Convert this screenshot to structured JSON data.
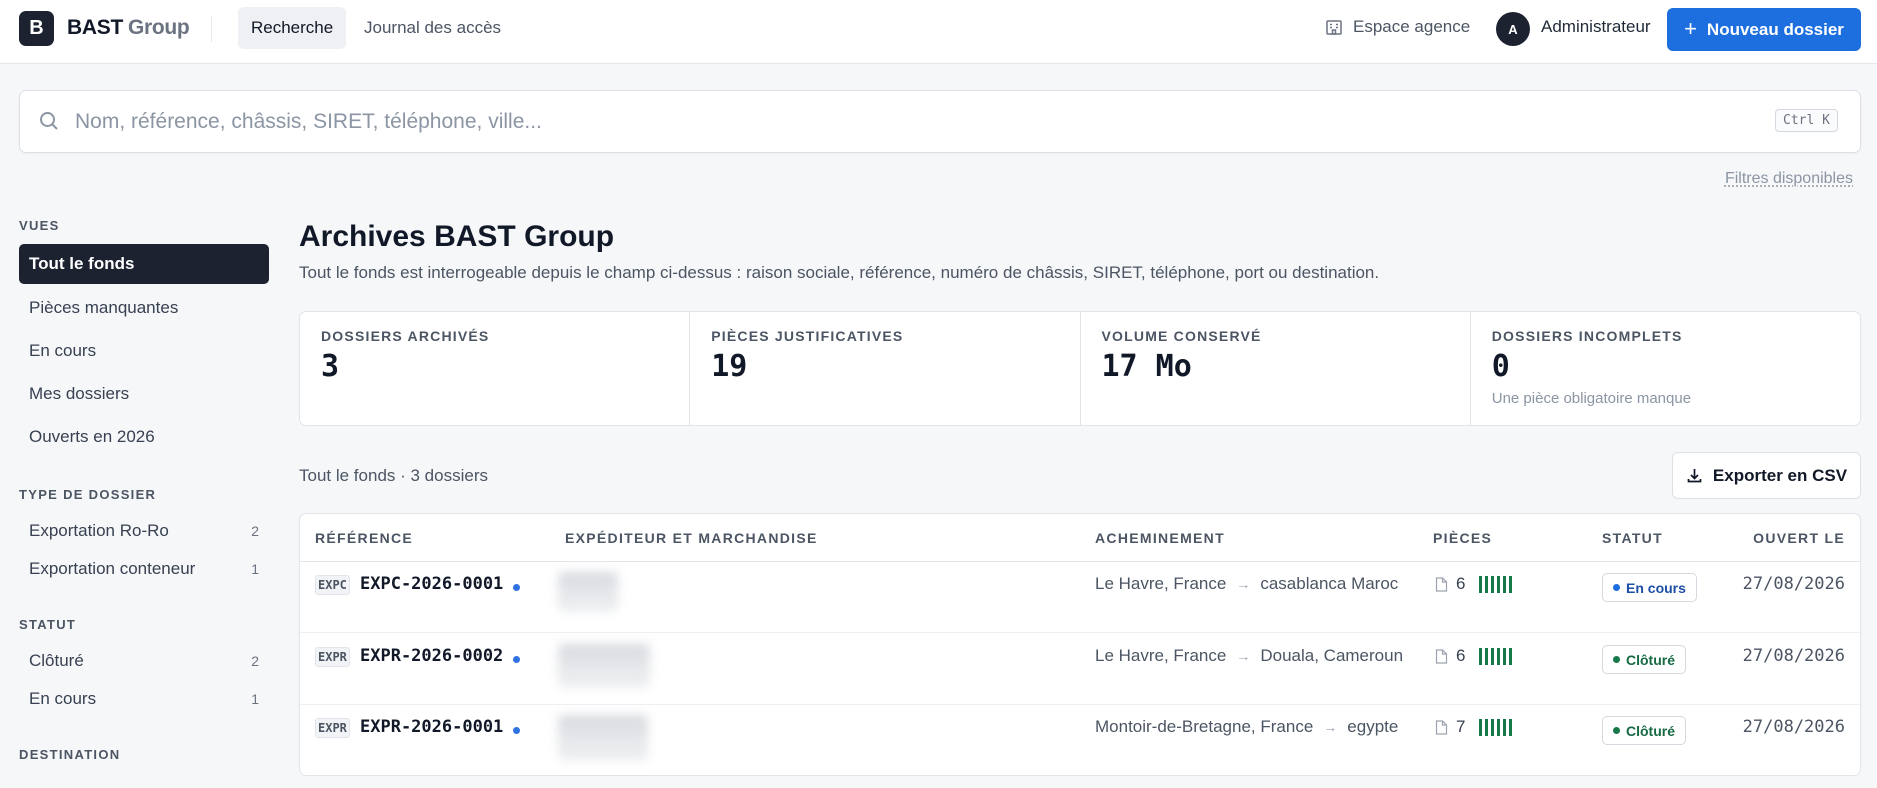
{
  "brand": {
    "logo_letter": "B",
    "name": "BAST",
    "name_suffix": "Group"
  },
  "nav": [
    {
      "label": "Recherche",
      "active": true
    },
    {
      "label": "Journal des accès",
      "active": false
    }
  ],
  "header": {
    "agence_label": "Espace agence",
    "avatar_initial": "A",
    "user_name": "Administrateur",
    "new_button": "Nouveau dossier"
  },
  "search": {
    "placeholder": "Nom, référence, châssis, SIRET, téléphone, ville...",
    "value": "",
    "shortcut": "Ctrl K",
    "filters_link": "Filtres disponibles"
  },
  "sidebar": {
    "vues": {
      "heading": "VUES",
      "items": [
        {
          "label": "Tout le fonds",
          "active": true
        },
        {
          "label": "Pièces manquantes"
        },
        {
          "label": "En cours"
        },
        {
          "label": "Mes dossiers"
        },
        {
          "label": "Ouverts en 2026"
        }
      ]
    },
    "type": {
      "heading": "TYPE DE DOSSIER",
      "items": [
        {
          "label": "Exportation Ro-Ro",
          "count": "2"
        },
        {
          "label": "Exportation conteneur",
          "count": "1"
        }
      ]
    },
    "statut": {
      "heading": "STATUT",
      "items": [
        {
          "label": "Clôturé",
          "count": "2"
        },
        {
          "label": "En cours",
          "count": "1"
        }
      ]
    },
    "destination": {
      "heading": "DESTINATION"
    }
  },
  "main": {
    "title": "Archives BAST Group",
    "subtitle": "Tout le fonds est interrogeable depuis le champ ci-dessus : raison sociale, référence, numéro de châssis, SIRET, téléphone, port ou destination.",
    "stats": [
      {
        "label": "DOSSIERS ARCHIVÉS",
        "value": "3",
        "note": ""
      },
      {
        "label": "PIÈCES JUSTIFICATIVES",
        "value": "19",
        "note": ""
      },
      {
        "label": "VOLUME CONSERVÉ",
        "value": "17 Mo",
        "note": ""
      },
      {
        "label": "DOSSIERS INCOMPLETS",
        "value": "0",
        "note": "Une pièce obligatoire manque"
      }
    ],
    "list_caption": "Tout le fonds · 3 dossiers",
    "export_button": "Exporter en CSV"
  },
  "table": {
    "headers": {
      "reference": "RÉFÉRENCE",
      "expediteur": "EXPÉDITEUR ET MARCHANDISE",
      "acheminement": "ACHEMINEMENT",
      "pieces": "PIÈCES",
      "statut": "STATUT",
      "ouvert": "OUVERT LE"
    },
    "rows": [
      {
        "tag": "EXPC",
        "ref": "EXPC-2026-0001",
        "from": "Le Havre, France",
        "to": "casablanca Maroc",
        "pieces": "6",
        "status": "En cours",
        "status_color": "#1d6fe0",
        "date": "27/08/2026"
      },
      {
        "tag": "EXPR",
        "ref": "EXPR-2026-0002",
        "from": "Le Havre, France",
        "to": "Douala, Cameroun",
        "pieces": "6",
        "status": "Clôturé",
        "status_color": "#17794a",
        "date": "27/08/2026"
      },
      {
        "tag": "EXPR",
        "ref": "EXPR-2026-0001",
        "from": "Montoir-de-Bretagne, France",
        "to": "egypte",
        "pieces": "7",
        "status": "Clôturé",
        "status_color": "#17794a",
        "date": "27/08/2026"
      }
    ]
  },
  "colors": {
    "accent": "#1d6fe0",
    "dark": "#1c2230",
    "success": "#17794a"
  }
}
